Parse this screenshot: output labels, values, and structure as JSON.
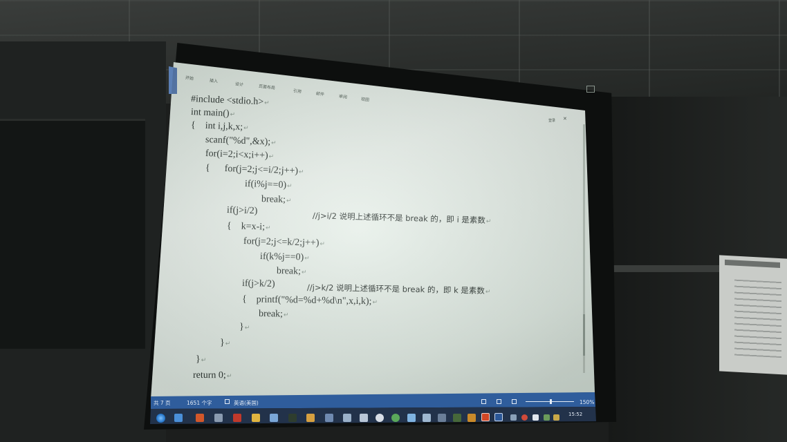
{
  "ribbon": {
    "tabs": [
      "开始",
      "插入",
      "设计",
      "页面布局",
      "引用",
      "邮件",
      "审阅",
      "视图"
    ],
    "login": "登录"
  },
  "code": {
    "lines": [
      "#include <stdio.h>",
      "int main()",
      "{    int i,j,k,x;",
      "scanf(\"%d\",&x);",
      "for(i=2;i<x;i++)",
      "{      for(j=2;j<=i/2;j++)",
      "if(i%j==0)",
      "break;",
      "if(j>i/2)",
      "{    k=x-i;",
      "for(j=2;j<=k/2;j++)",
      "if(k%j==0)",
      "break;",
      "if(j>k/2)",
      "{    printf(\"%d=%d+%d\\n\",x,i,k);",
      "break;",
      "}",
      "}",
      "}",
      "return 0;"
    ],
    "comments": [
      "//j>i/2 说明上述循环不是 break 的，即 i 是素数",
      "//j>k/2 说明上述循环不是 break 的，即 k 是素数"
    ],
    "para_mark": "↵"
  },
  "statusbar": {
    "pages": "共 7 页",
    "words": "1651 个字",
    "language": "英语(美国)",
    "zoom": "150%",
    "zoom_fraction": 0.5
  },
  "taskbar": {
    "time": "15:52"
  },
  "colors": {
    "statusbar": "#2f5d9c",
    "taskbar": "#22324a",
    "code_text": "#2b3430"
  }
}
